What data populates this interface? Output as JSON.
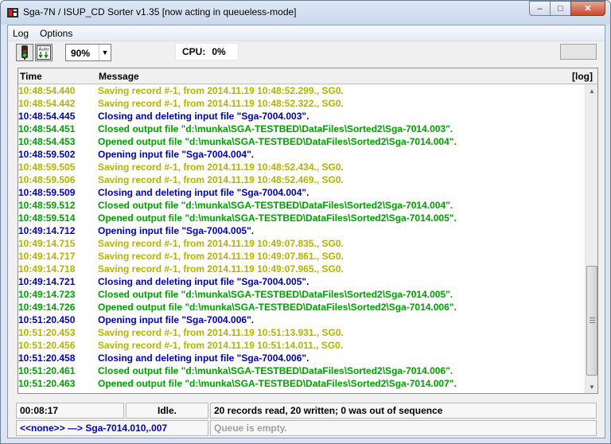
{
  "window": {
    "title": "Sga-7N / ISUP_CD Sorter  v1.35  [now acting in queueless-mode]",
    "controls": {
      "minimize": "–",
      "maximize": "□",
      "close": "✕"
    }
  },
  "menu": {
    "log": "Log",
    "options": "Options"
  },
  "toolbar": {
    "zoom_value": "90%",
    "zoom_dropdown_icon": "▼",
    "cpu_label": "CPU:",
    "cpu_value": "0%"
  },
  "log": {
    "columns": {
      "time": "Time",
      "message": "Message",
      "log_toggle": "[log]"
    },
    "colors": {
      "olive": "#b4b400",
      "navy": "#0000b4",
      "green": "#00a000"
    },
    "rows": [
      {
        "time": "10:48:54.440",
        "message": "Saving record #-1, from 2014.11.19 10:48:52.299., SG0.",
        "color": "olive"
      },
      {
        "time": "10:48:54.442",
        "message": "Saving record #-1, from 2014.11.19 10:48:52.322., SG0.",
        "color": "olive"
      },
      {
        "time": "10:48:54.445",
        "message": "Closing and deleting input file \"Sga-7004.003\".",
        "color": "navy"
      },
      {
        "time": "10:48:54.451",
        "message": "Closed output file \"d:\\munka\\SGA-TESTBED\\DataFiles\\Sorted2\\Sga-7014.003\".",
        "color": "green"
      },
      {
        "time": "10:48:54.453",
        "message": "Opened output file \"d:\\munka\\SGA-TESTBED\\DataFiles\\Sorted2\\Sga-7014.004\".",
        "color": "green"
      },
      {
        "time": "10:48:59.502",
        "message": "Opening input file \"Sga-7004.004\".",
        "color": "navy"
      },
      {
        "time": "10:48:59.505",
        "message": "Saving record #-1, from 2014.11.19 10:48:52.434., SG0.",
        "color": "olive"
      },
      {
        "time": "10:48:59.506",
        "message": "Saving record #-1, from 2014.11.19 10:48:52.469., SG0.",
        "color": "olive"
      },
      {
        "time": "10:48:59.509",
        "message": "Closing and deleting input file \"Sga-7004.004\".",
        "color": "navy"
      },
      {
        "time": "10:48:59.512",
        "message": "Closed output file \"d:\\munka\\SGA-TESTBED\\DataFiles\\Sorted2\\Sga-7014.004\".",
        "color": "green"
      },
      {
        "time": "10:48:59.514",
        "message": "Opened output file \"d:\\munka\\SGA-TESTBED\\DataFiles\\Sorted2\\Sga-7014.005\".",
        "color": "green"
      },
      {
        "time": "10:49:14.712",
        "message": "Opening input file \"Sga-7004.005\".",
        "color": "navy"
      },
      {
        "time": "10:49:14.715",
        "message": "Saving record #-1, from 2014.11.19 10:49:07.835., SG0.",
        "color": "olive"
      },
      {
        "time": "10:49:14.717",
        "message": "Saving record #-1, from 2014.11.19 10:49:07.861., SG0.",
        "color": "olive"
      },
      {
        "time": "10:49:14.718",
        "message": "Saving record #-1, from 2014.11.19 10:49:07.965., SG0.",
        "color": "olive"
      },
      {
        "time": "10:49:14.721",
        "message": "Closing and deleting input file \"Sga-7004.005\".",
        "color": "navy"
      },
      {
        "time": "10:49:14.723",
        "message": "Closed output file \"d:\\munka\\SGA-TESTBED\\DataFiles\\Sorted2\\Sga-7014.005\".",
        "color": "green"
      },
      {
        "time": "10:49:14.726",
        "message": "Opened output file \"d:\\munka\\SGA-TESTBED\\DataFiles\\Sorted2\\Sga-7014.006\".",
        "color": "green"
      },
      {
        "time": "10:51:20.450",
        "message": "Opening input file \"Sga-7004.006\".",
        "color": "navy"
      },
      {
        "time": "10:51:20.453",
        "message": "Saving record #-1, from 2014.11.19 10:51:13.931., SG0.",
        "color": "olive"
      },
      {
        "time": "10:51:20.456",
        "message": "Saving record #-1, from 2014.11.19 10:51:14.011., SG0.",
        "color": "olive"
      },
      {
        "time": "10:51:20.458",
        "message": "Closing and deleting input file \"Sga-7004.006\".",
        "color": "navy"
      },
      {
        "time": "10:51:20.461",
        "message": "Closed output file \"d:\\munka\\SGA-TESTBED\\DataFiles\\Sorted2\\Sga-7014.006\".",
        "color": "green"
      },
      {
        "time": "10:51:20.463",
        "message": "Opened output file \"d:\\munka\\SGA-TESTBED\\DataFiles\\Sorted2\\Sga-7014.007\".",
        "color": "green"
      }
    ]
  },
  "status": {
    "elapsed": "00:08:17",
    "state": "Idle.",
    "summary": "20 records read, 20 written; 0 was out of sequence",
    "route": "<<none>> —> Sga-7014.010,.007",
    "queue": "Queue is empty.",
    "route_color": "#0000b4",
    "queue_color": "#a0a0a0"
  },
  "scrollbar": {
    "up_icon": "▲",
    "down_icon": "▼"
  }
}
